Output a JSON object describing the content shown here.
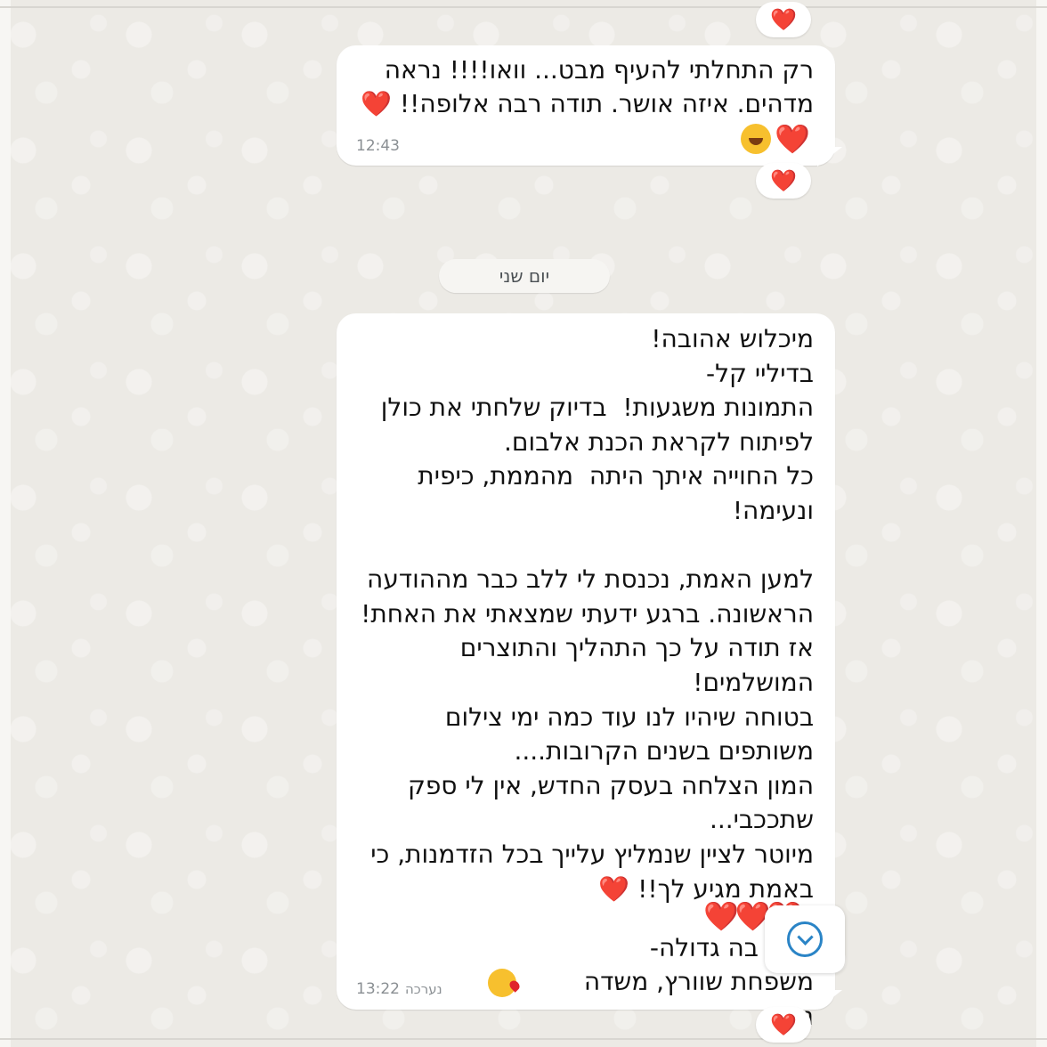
{
  "chat": {
    "reactions": {
      "top": "❤️",
      "after_first": "❤️",
      "bottom": "❤️"
    },
    "message_1": {
      "line_1": "רק התחלתי להעיף מבט... וואו!!!! נראה",
      "line_2": "מדהים. איזה אושר. תודה רבה אלופה!! ❤️",
      "line_3": "❤️",
      "time": "12:43"
    },
    "date_separator": "יום שני",
    "message_2": {
      "lines": [
        "מיכלוש אהובה!",
        "בדיליי קל-",
        "התמונות משגעות!  בדיוק שלחתי את כולן",
        "לפיתוח לקראת הכנת אלבום.",
        "כל החוייה איתך היתה  מהממת, כיפית",
        "ונעימה!",
        "",
        "למען האמת, נכנסת לי ללב כבר מההודעה",
        "הראשונה. ברגע ידעתי שמצאתי את האחת!",
        "אז תודה על כך התהליך והתוצרים",
        "המושלמים!",
        "בטוחה שיהיו לנו עוד כמה ימי צילום",
        "משותפים בשנים הקרובות....",
        "המון הצלחה בעסק החדש, אין לי ספק",
        "שתככבי...",
        "מיוטר לציין שנמליץ עלייך בכל הזדמנות, כי",
        "באמת מגיע לך!! ❤️"
      ],
      "stacked_hearts": "❤️❤️❤️",
      "signoff_1": "בה גדולה-",
      "signoff_2": "משפחת שוורץ, משדה נחום",
      "edited_label": "נערכה",
      "time": "13:22"
    }
  },
  "colors": {
    "background": "#eceae5",
    "bubble": "#ffffff",
    "heart": "#e0242b",
    "time_text": "#8a8f93",
    "scroll_icon": "#2a84c6"
  },
  "icons": {
    "scroll_down": "chevron-down-circle-icon",
    "laugh": "face-with-tears-of-joy-icon",
    "kiss": "face-blowing-kiss-icon"
  }
}
